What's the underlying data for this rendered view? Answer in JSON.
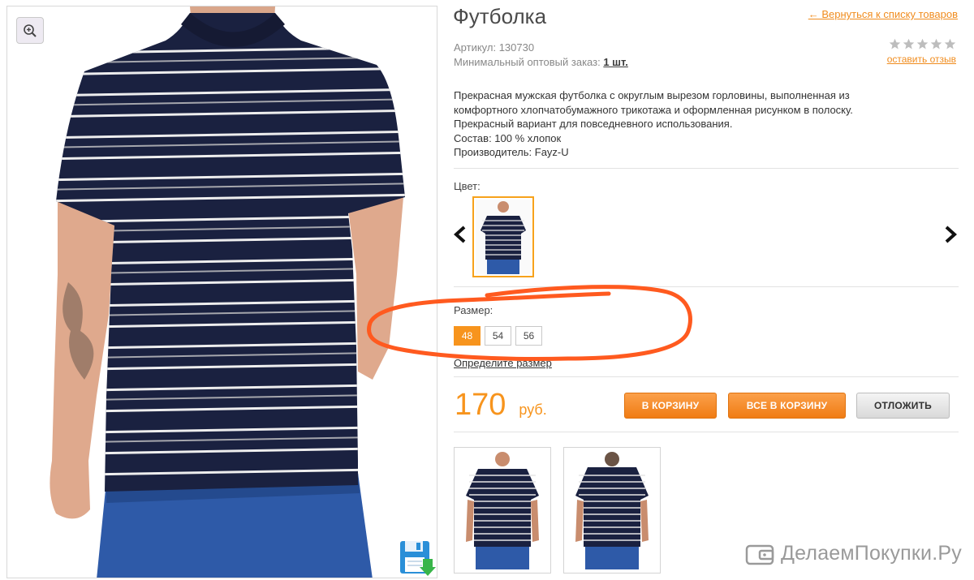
{
  "product": {
    "title": "Футболка",
    "back_link": "← Вернуться к списку товаров",
    "sku_label": "Артикул:",
    "sku_value": "130730",
    "min_order_label": "Минимальный оптовый заказ:",
    "min_order_value": "1 шт.",
    "rating": {
      "stars_filled": 0,
      "stars_total": 5
    },
    "review_link": "оставить отзыв",
    "description": [
      "Прекрасная мужская футболка с округлым вырезом горловины, выполненная из",
      "комфортного хлопчатобумажного трикотажа и оформленная рисунком в полоску.",
      "Прекрасный вариант для повседневного использования.",
      "Состав: 100 % хлопок",
      "Производитель: Fayz-U"
    ]
  },
  "color": {
    "label": "Цвет:",
    "selected": "navy-stripe"
  },
  "size": {
    "label": "Размер:",
    "options": [
      "48",
      "54",
      "56"
    ],
    "selected": "48",
    "help_link": "Определите размер"
  },
  "price": {
    "value": "170",
    "currency": "руб."
  },
  "actions": {
    "add_to_cart": "В КОРЗИНУ",
    "add_all_to_cart": "ВСЕ В КОРЗИНУ",
    "postpone": "ОТЛОЖИТЬ"
  },
  "thumbnails": [
    "front",
    "back"
  ],
  "watermark": "ДелаемПокупки.Ру",
  "colors": {
    "accent": "#f7941d",
    "link": "#f08c1e",
    "annotation": "#ff5a1f",
    "shirt": "#1a2140",
    "jeans": "#2e5aa8"
  }
}
